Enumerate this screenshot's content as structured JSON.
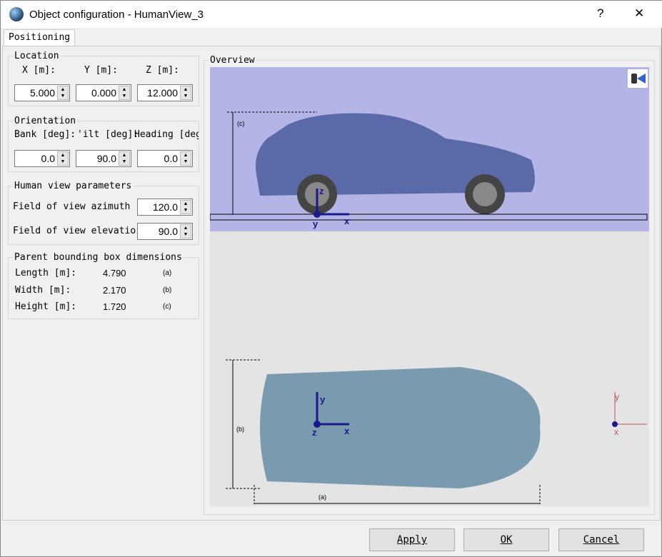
{
  "window": {
    "title": "Object configuration - HumanView_3",
    "help": "?",
    "close": "✕"
  },
  "tab": "Positioning",
  "location": {
    "legend": "Location",
    "x_label": "X  [m]:",
    "y_label": "Y [m]:",
    "z_label": "Z [m]:",
    "x": "5.000",
    "y": "0.000",
    "z": "12.000"
  },
  "orientation": {
    "legend": "Orientation",
    "bank_label": "Bank [deg]:",
    "tilt_label": "'ilt [deg]:",
    "heading_label": "Heading [deg",
    "bank": "0.0",
    "tilt": "90.0",
    "heading": "0.0"
  },
  "human_view": {
    "legend": "Human view parameters",
    "azimuth_label": "Field of view azimuth [",
    "azimuth": "120.0",
    "elevation_label": "Field of view elevation",
    "elevation": "90.0"
  },
  "bbox": {
    "legend": "Parent bounding box dimensions",
    "rows": [
      {
        "label": "Length [m]:",
        "value": "4.790",
        "tag": "(a)"
      },
      {
        "label": "Width [m]:",
        "value": "2.170",
        "tag": "(b)"
      },
      {
        "label": "Height [m]:",
        "value": "1.720",
        "tag": "(c)"
      }
    ]
  },
  "overview": {
    "legend": "Overview",
    "axes": {
      "x": "x",
      "y": "y",
      "z": "z"
    },
    "tags": {
      "a": "(a)",
      "b": "(b)",
      "c": "(c)"
    }
  },
  "buttons": {
    "apply": "Apply",
    "ok": "OK",
    "cancel": "Cancel"
  },
  "colors": {
    "side_bg": "#b4b4e6",
    "top_bg": "#e4e4e4",
    "axis": "#1a1a8c",
    "car_side": "#5a6aa8",
    "car_top": "#7a9ab0"
  }
}
